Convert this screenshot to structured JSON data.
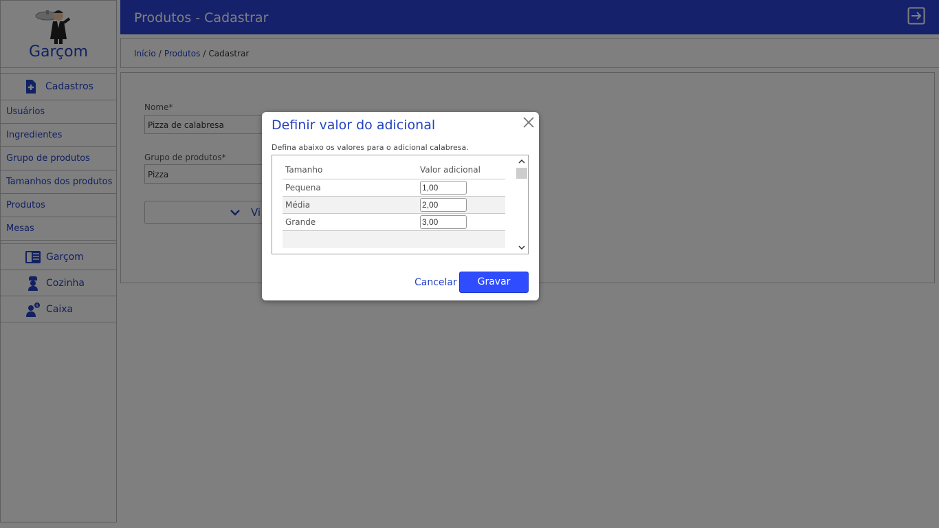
{
  "sidebar": {
    "logo_text": "Garçom",
    "cadastros_label": "Cadastros",
    "items": [
      {
        "label": "Usuários"
      },
      {
        "label": "Ingredientes"
      },
      {
        "label": "Grupo de produtos"
      },
      {
        "label": "Tamanhos dos produtos"
      },
      {
        "label": "Produtos"
      },
      {
        "label": "Mesas"
      }
    ],
    "sections": [
      {
        "label": "Garçom",
        "icon": "waiter-panel-icon"
      },
      {
        "label": "Cozinha",
        "icon": "chef-icon"
      },
      {
        "label": "Caixa",
        "icon": "cashier-icon"
      }
    ]
  },
  "header": {
    "title": "Produtos - Cadastrar",
    "logout_icon": "logout-icon"
  },
  "breadcrumb": {
    "home": "Início",
    "sep1": "/",
    "section": "Produtos",
    "sep2": "/",
    "current": "Cadastrar"
  },
  "form": {
    "name_label": "Nome*",
    "name_value": "Pizza de calabresa",
    "group_label": "Grupo de produtos*",
    "group_value": "Pizza",
    "more_button_partial": "Vi"
  },
  "modal": {
    "title": "Definir valor do adicional",
    "description": "Defina abaixo os valores para o adicional calabresa.",
    "columns": [
      "Tamanho",
      "Valor adicional"
    ],
    "rows": [
      {
        "size": "Pequena",
        "value": "1,00"
      },
      {
        "size": "Média",
        "value": "2,00"
      },
      {
        "size": "Grande",
        "value": "3,00"
      }
    ],
    "cancel_label": "Cancelar",
    "save_label": "Gravar"
  },
  "colors": {
    "accent": "#2b43d6",
    "link": "#2342c4",
    "save_button": "#2f4dff"
  }
}
